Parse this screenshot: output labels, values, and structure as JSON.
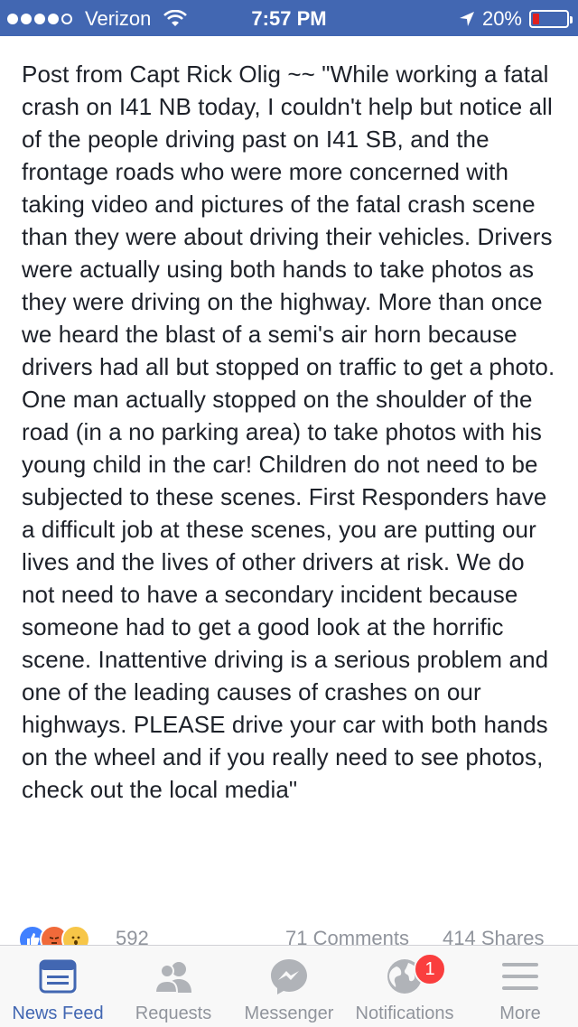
{
  "status_bar": {
    "carrier": "Verizon",
    "time": "7:57 PM",
    "battery": "20%",
    "battery_level": 0.2
  },
  "post": {
    "text": "Post from Capt Rick Olig ~~ \"While working a fatal crash on I41 NB today, I couldn't help but notice all of the people driving past on I41 SB, and the frontage roads who were more concerned with taking video and pictures of the fatal crash scene than they were about driving their vehicles. Drivers were actually using both hands to take photos as they were driving on the highway. More than once we heard the blast of a semi's air horn because drivers had all but stopped on traffic to get a photo.\nOne man actually stopped on the shoulder of the road (in a no parking area) to take photos with his young child in the car! Children do not need to be subjected to these scenes. First Responders have a difficult job at these scenes, you are putting our lives and the lives of other drivers at risk. We do not need to have a secondary incident because someone had to get a good look at the horrific scene. Inattentive driving is a serious problem and one of the leading causes of crashes on our highways. PLEASE drive your car with both hands on the wheel and if you really need to see photos, check out the local media\""
  },
  "reactions": {
    "count": "592",
    "comments": "71 Comments",
    "shares": "414 Shares"
  },
  "tabs": [
    {
      "label": "News Feed",
      "icon": "news-feed-icon",
      "active": true
    },
    {
      "label": "Requests",
      "icon": "friend-requests-icon",
      "active": false
    },
    {
      "label": "Messenger",
      "icon": "messenger-icon",
      "active": false
    },
    {
      "label": "Notifications",
      "icon": "globe-icon",
      "active": false,
      "badge": "1"
    },
    {
      "label": "More",
      "icon": "menu-icon",
      "active": false
    }
  ],
  "colors": {
    "brand": "#4267b2",
    "badge": "#fa3e3e",
    "inactive": "#90949c"
  }
}
